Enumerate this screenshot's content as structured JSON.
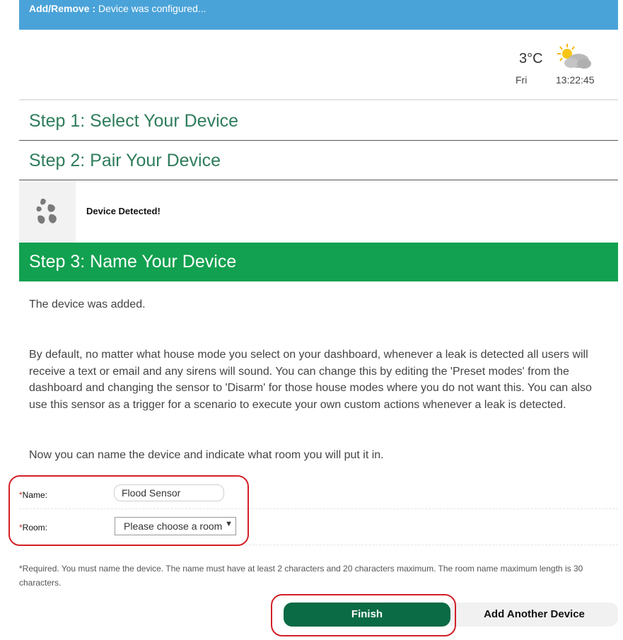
{
  "notification": {
    "prefix": "Add/Remove :",
    "message": " Device was configured..."
  },
  "weather": {
    "temperature": "3°C",
    "day": "Fri",
    "time": "13:22:45",
    "icon": "partly-cloudy-icon"
  },
  "steps": {
    "step1": "Step 1: Select Your Device",
    "step2": "Step 2: Pair Your Device",
    "step3": "Step 3: Name Your Device"
  },
  "detection": {
    "icon": "flood-sensor-icon",
    "status": "Device Detected!"
  },
  "content": {
    "added": "The device was added.",
    "description": "By default, no matter what house mode you select on your dashboard, whenever a leak is detected all users will receive a text or email and any sirens will sound. You can change this by editing the 'Preset modes' from the dashboard and changing the sensor to 'Disarm' for those house modes where you do not want this. You can also use this sensor as a trigger for a scenario to execute your own custom actions whenever a leak is detected.",
    "instruction": "Now you can name the device and indicate what room you will put it in."
  },
  "form": {
    "required_mark": "*",
    "name_label": "Name:",
    "name_value": "Flood Sensor",
    "room_label": "Room:",
    "room_value": "Please choose a room"
  },
  "note": "*Required. You must name the device. The name must have at least 2 characters and 20 characters maximum. The room name maximum length is 30 characters.",
  "buttons": {
    "finish": "Finish",
    "add_another": "Add Another Device"
  },
  "colors": {
    "accent_blue": "#4aa3d8",
    "step_green": "#12a150",
    "finish_green": "#0a6b44",
    "highlight_red": "#d32027"
  }
}
